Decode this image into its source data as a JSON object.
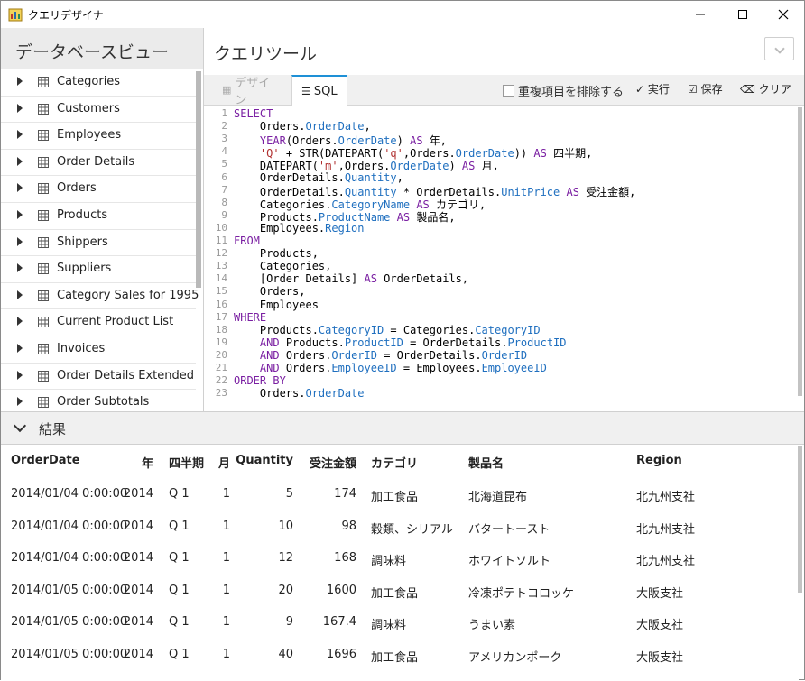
{
  "window": {
    "title": "クエリデザイナ"
  },
  "left_panel": {
    "title": "データベースビュー",
    "items": [
      "Categories",
      "Customers",
      "Employees",
      "Order Details",
      "Orders",
      "Products",
      "Shippers",
      "Suppliers",
      "Category Sales for 1995",
      "Current Product List",
      "Invoices",
      "Order Details Extended",
      "Order Subtotals"
    ]
  },
  "tool": {
    "title": "クエリツール",
    "tabs": [
      {
        "label": "デザイン",
        "active": false
      },
      {
        "label": "SQL",
        "active": true
      }
    ],
    "distinct_checkbox": {
      "label": "重複項目を排除する",
      "checked": false
    },
    "run_label": "実行",
    "save_label": "保存",
    "clear_label": "クリア"
  },
  "sql": {
    "line_numbers": [
      "1",
      "2",
      "3",
      "4",
      "5",
      "6",
      "7",
      "8",
      "9",
      "10",
      "11",
      "12",
      "13",
      "14",
      "15",
      "16",
      "17",
      "18",
      "19",
      "20",
      "21",
      "22",
      "23"
    ],
    "lines": [
      [
        [
          "SELECT",
          "kw"
        ]
      ],
      [
        [
          "    Orders.",
          ""
        ],
        [
          "OrderDate",
          "fld"
        ],
        [
          ",",
          ""
        ]
      ],
      [
        [
          "    ",
          ""
        ],
        [
          "YEAR",
          "fn"
        ],
        [
          "(Orders.",
          ""
        ],
        [
          "OrderDate",
          "fld"
        ],
        [
          ") ",
          ""
        ],
        [
          "AS",
          "kw"
        ],
        [
          " 年,",
          ""
        ]
      ],
      [
        [
          "    ",
          ""
        ],
        [
          "'Q'",
          "str"
        ],
        [
          " + STR(DATEPART(",
          ""
        ],
        [
          "'q'",
          "str"
        ],
        [
          ",Orders.",
          ""
        ],
        [
          "OrderDate",
          "fld"
        ],
        [
          ")) ",
          ""
        ],
        [
          "AS",
          "kw"
        ],
        [
          " 四半期,",
          ""
        ]
      ],
      [
        [
          "    DATEPART(",
          ""
        ],
        [
          "'m'",
          "str"
        ],
        [
          ",Orders.",
          ""
        ],
        [
          "OrderDate",
          "fld"
        ],
        [
          ") ",
          ""
        ],
        [
          "AS",
          "kw"
        ],
        [
          " 月,",
          ""
        ]
      ],
      [
        [
          "    OrderDetails.",
          ""
        ],
        [
          "Quantity",
          "fld"
        ],
        [
          ",",
          ""
        ]
      ],
      [
        [
          "    OrderDetails.",
          ""
        ],
        [
          "Quantity",
          "fld"
        ],
        [
          " * OrderDetails.",
          ""
        ],
        [
          "UnitPrice",
          "fld"
        ],
        [
          " ",
          ""
        ],
        [
          "AS",
          "kw"
        ],
        [
          " 受注金額,",
          ""
        ]
      ],
      [
        [
          "    Categories.",
          ""
        ],
        [
          "CategoryName",
          "fld"
        ],
        [
          " ",
          ""
        ],
        [
          "AS",
          "kw"
        ],
        [
          " カテゴリ,",
          ""
        ]
      ],
      [
        [
          "    Products.",
          ""
        ],
        [
          "ProductName",
          "fld"
        ],
        [
          " ",
          ""
        ],
        [
          "AS",
          "kw"
        ],
        [
          " 製品名,",
          ""
        ]
      ],
      [
        [
          "    Employees.",
          ""
        ],
        [
          "Region",
          "fld"
        ]
      ],
      [
        [
          "FROM",
          "kw"
        ]
      ],
      [
        [
          "    Products,",
          ""
        ]
      ],
      [
        [
          "    Categories,",
          ""
        ]
      ],
      [
        [
          "    [Order Details] ",
          ""
        ],
        [
          "AS",
          "kw"
        ],
        [
          " OrderDetails,",
          ""
        ]
      ],
      [
        [
          "    Orders,",
          ""
        ]
      ],
      [
        [
          "    Employees",
          ""
        ]
      ],
      [
        [
          "WHERE",
          "kw"
        ]
      ],
      [
        [
          "    Products.",
          ""
        ],
        [
          "CategoryID",
          "fld"
        ],
        [
          " = Categories.",
          ""
        ],
        [
          "CategoryID",
          "fld"
        ]
      ],
      [
        [
          "    ",
          ""
        ],
        [
          "AND",
          "kw"
        ],
        [
          " Products.",
          ""
        ],
        [
          "ProductID",
          "fld"
        ],
        [
          " = OrderDetails.",
          ""
        ],
        [
          "ProductID",
          "fld"
        ]
      ],
      [
        [
          "    ",
          ""
        ],
        [
          "AND",
          "kw"
        ],
        [
          " Orders.",
          ""
        ],
        [
          "OrderID",
          "fld"
        ],
        [
          " = OrderDetails.",
          ""
        ],
        [
          "OrderID",
          "fld"
        ]
      ],
      [
        [
          "    ",
          ""
        ],
        [
          "AND",
          "kw"
        ],
        [
          " Orders.",
          ""
        ],
        [
          "EmployeeID",
          "fld"
        ],
        [
          " = Employees.",
          ""
        ],
        [
          "EmployeeID",
          "fld"
        ]
      ],
      [
        [
          "ORDER BY",
          "kw"
        ]
      ],
      [
        [
          "    Orders.",
          ""
        ],
        [
          "OrderDate",
          "fld"
        ]
      ]
    ]
  },
  "results": {
    "title": "結果",
    "columns": [
      "OrderDate",
      "年",
      "四半期",
      "月",
      "Quantity",
      "受注金額",
      "カテゴリ",
      "製品名",
      "Region"
    ],
    "rows": [
      [
        "2014/01/04 0:00:00",
        "2014",
        "Q 1",
        "1",
        "5",
        "174",
        "加工食品",
        "北海道昆布",
        "北九州支社"
      ],
      [
        "2014/01/04 0:00:00",
        "2014",
        "Q 1",
        "1",
        "10",
        "98",
        "穀類、シリアル",
        "バタートースト",
        "北九州支社"
      ],
      [
        "2014/01/04 0:00:00",
        "2014",
        "Q 1",
        "1",
        "12",
        "168",
        "調味料",
        "ホワイトソルト",
        "北九州支社"
      ],
      [
        "2014/01/05 0:00:00",
        "2014",
        "Q 1",
        "1",
        "20",
        "1600",
        "加工食品",
        "冷凍ポテトコロッケ",
        "大阪支社"
      ],
      [
        "2014/01/05 0:00:00",
        "2014",
        "Q 1",
        "1",
        "9",
        "167.4",
        "調味料",
        "うまい素",
        "大阪支社"
      ],
      [
        "2014/01/05 0:00:00",
        "2014",
        "Q 1",
        "1",
        "40",
        "1696",
        "加工食品",
        "アメリカンポーク",
        "大阪支社"
      ]
    ]
  },
  "colors": {
    "keyword": "#7a1fa2",
    "field": "#1f6fbf",
    "string": "#b03030",
    "accent": "#1e90d6"
  }
}
